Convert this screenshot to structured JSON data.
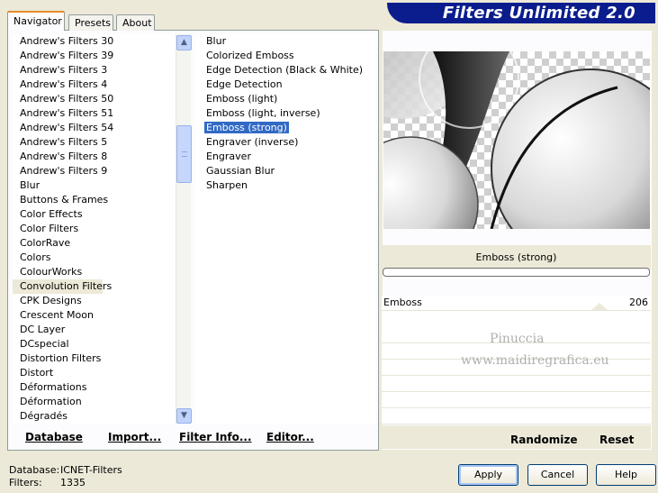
{
  "window": {
    "title": "Filters Unlimited 2.0"
  },
  "tabs": [
    {
      "label": "Navigator",
      "active": true
    },
    {
      "label": "Presets",
      "active": false
    },
    {
      "label": "About",
      "active": false
    }
  ],
  "categories": {
    "items": [
      "Andrew's Filters 30",
      "Andrew's Filters 39",
      "Andrew's Filters 3",
      "Andrew's Filters 4",
      "Andrew's Filters 50",
      "Andrew's Filters 51",
      "Andrew's Filters 54",
      "Andrew's Filters 5",
      "Andrew's Filters 8",
      "Andrew's Filters 9",
      "Blur",
      "Buttons & Frames",
      "Color Effects",
      "Color Filters",
      "ColorRave",
      "Colors",
      "ColourWorks",
      "Convolution Filters",
      "CPK Designs",
      "Crescent Moon",
      "DC Layer",
      "DCspecial",
      "Distortion Filters",
      "Distort",
      "Déformations",
      "Déformation",
      "Dégradés"
    ],
    "selected": "Convolution Filters"
  },
  "filters": {
    "items": [
      "Blur",
      "Colorized Emboss",
      "Edge Detection (Black & White)",
      "Edge Detection",
      "Emboss (light)",
      "Emboss (light, inverse)",
      "Emboss (strong)",
      "Engraver (inverse)",
      "Engraver",
      "Gaussian Blur",
      "Sharpen"
    ],
    "selected": "Emboss (strong)"
  },
  "left_buttons": {
    "database": "Database",
    "import": "Import...",
    "filter_info": "Filter Info...",
    "editor": "Editor..."
  },
  "preview": {
    "filter_name": "Emboss (strong)"
  },
  "parameters": [
    {
      "label": "Emboss",
      "value": "206"
    }
  ],
  "watermark": {
    "line1": "Pinuccia",
    "line2": "www.maidiregrafica.eu"
  },
  "right_buttons": {
    "randomize": "Randomize",
    "reset": "Reset"
  },
  "status": {
    "database_label": "Database:",
    "database_value": "ICNET-Filters",
    "filters_label": "Filters:",
    "filters_value": "1335"
  },
  "dialog_buttons": {
    "apply": "Apply",
    "cancel": "Cancel",
    "help": "Help"
  },
  "colors": {
    "banner": "#0b1d8c",
    "selection": "#316ac5",
    "dialog_bg": "#ece9d8"
  }
}
